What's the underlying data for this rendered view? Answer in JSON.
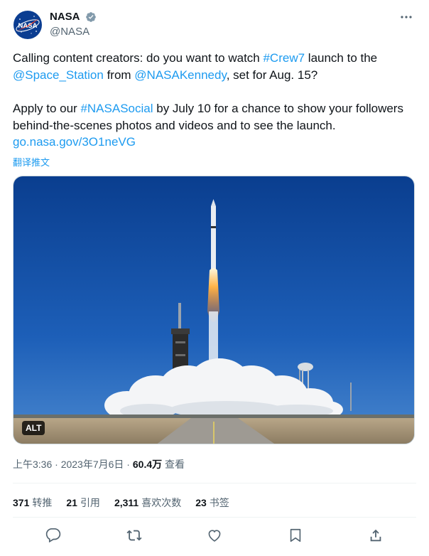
{
  "author": {
    "display_name": "NASA",
    "handle": "@NASA",
    "avatar_icon": "nasa-meatball-logo",
    "avatar_logo_text": "NASA",
    "verified_icon": "verified-badge-icon"
  },
  "tweet": {
    "p1_a": "Calling content creators: do you want to watch ",
    "p1_hashtag": "#Crew7",
    "p1_b": " launch to the ",
    "p1_mention1": "@Space_Station",
    "p1_c": " from ",
    "p1_mention2": "@NASAKennedy",
    "p1_d": ", set for Aug. 15?",
    "p2_a": "Apply to our ",
    "p2_hashtag": "#NASASocial",
    "p2_b": " by July 10 for a chance to show your followers behind-the-scenes photos and videos and to see the launch.",
    "p2_link": "go.nasa.gov/3O1neVG",
    "translate_label": "翻译推文"
  },
  "media": {
    "alt_badge": "ALT",
    "description_icon": "rocket-launch-photo"
  },
  "meta": {
    "time": "上午3:36",
    "separator": " · ",
    "date": "2023年7月6日",
    "views_count": "60.4万",
    "views_label": "查看"
  },
  "stats": [
    {
      "count": "371",
      "label": "转推"
    },
    {
      "count": "21",
      "label": "引用"
    },
    {
      "count": "2,311",
      "label": "喜欢次数"
    },
    {
      "count": "23",
      "label": "书签"
    }
  ],
  "actions": [
    "reply-icon",
    "retweet-icon",
    "like-icon",
    "bookmark-icon",
    "share-icon"
  ],
  "colors": {
    "link": "#1d9bf0",
    "secondary_text": "#536471",
    "primary_text": "#0f1419"
  }
}
